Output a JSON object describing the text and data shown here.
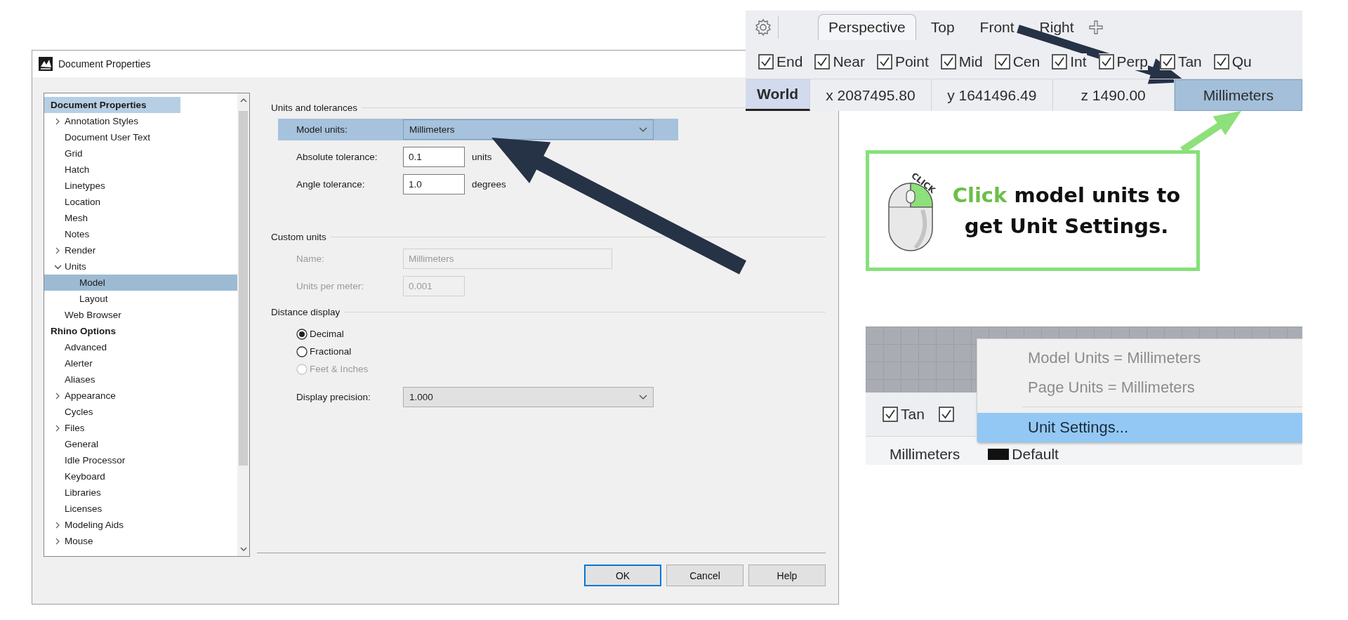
{
  "dialog": {
    "title": "Document Properties",
    "tree": [
      {
        "label": "Document Properties",
        "kind": "heading",
        "highlighted": true,
        "selected": false,
        "children": [
          {
            "label": "Annotation Styles",
            "kind": "item",
            "selected": false,
            "expanded": false
          },
          {
            "label": "Document User Text",
            "kind": "item",
            "selected": false
          },
          {
            "label": "Grid",
            "kind": "item",
            "selected": false
          },
          {
            "label": "Hatch",
            "kind": "item",
            "selected": false
          },
          {
            "label": "Linetypes",
            "kind": "item",
            "selected": false
          },
          {
            "label": "Location",
            "kind": "item",
            "selected": false
          },
          {
            "label": "Mesh",
            "kind": "item",
            "selected": false
          },
          {
            "label": "Notes",
            "kind": "item",
            "selected": false
          },
          {
            "label": "Render",
            "kind": "item",
            "selected": false,
            "expanded": false
          },
          {
            "label": "Units",
            "kind": "item",
            "selected": false,
            "expanded": true,
            "children": [
              {
                "label": "Model",
                "kind": "item",
                "selected": true
              },
              {
                "label": "Layout",
                "kind": "item",
                "selected": false
              }
            ]
          },
          {
            "label": "Web Browser",
            "kind": "item",
            "selected": false
          }
        ]
      },
      {
        "label": "Rhino Options",
        "kind": "heading",
        "highlighted": false,
        "selected": false,
        "children": [
          {
            "label": "Advanced",
            "kind": "item",
            "selected": false
          },
          {
            "label": "Alerter",
            "kind": "item",
            "selected": false
          },
          {
            "label": "Aliases",
            "kind": "item",
            "selected": false
          },
          {
            "label": "Appearance",
            "kind": "item",
            "selected": false,
            "expanded": false
          },
          {
            "label": "Cycles",
            "kind": "item",
            "selected": false
          },
          {
            "label": "Files",
            "kind": "item",
            "selected": false,
            "expanded": false
          },
          {
            "label": "General",
            "kind": "item",
            "selected": false
          },
          {
            "label": "Idle Processor",
            "kind": "item",
            "selected": false
          },
          {
            "label": "Keyboard",
            "kind": "item",
            "selected": false
          },
          {
            "label": "Libraries",
            "kind": "item",
            "selected": false
          },
          {
            "label": "Licenses",
            "kind": "item",
            "selected": false
          },
          {
            "label": "Modeling Aids",
            "kind": "item",
            "selected": false,
            "expanded": false
          },
          {
            "label": "Mouse",
            "kind": "item",
            "selected": false,
            "expanded": false
          }
        ]
      }
    ],
    "groups": [
      {
        "title": "Units and tolerances",
        "rows": [
          {
            "kind": "select",
            "label": "Model units:",
            "value": "Millimeters",
            "highlighted": true,
            "disabled": false
          },
          {
            "kind": "text",
            "label": "Absolute tolerance:",
            "value": "0.1",
            "suffix": "units",
            "highlighted": false,
            "disabled": false
          },
          {
            "kind": "text",
            "label": "Angle tolerance:",
            "value": "1.0",
            "suffix": "degrees",
            "highlighted": false,
            "disabled": false
          }
        ]
      },
      {
        "title": "Custom units",
        "rows": [
          {
            "kind": "wide-text",
            "label": "Name:",
            "value": "Millimeters",
            "highlighted": false,
            "disabled": true
          },
          {
            "kind": "text",
            "label": "Units per meter:",
            "value": "0.001",
            "highlighted": false,
            "disabled": true
          }
        ]
      },
      {
        "title": "Distance display",
        "rows": [
          {
            "kind": "radio",
            "label": "Decimal",
            "selected": true,
            "disabled": false
          },
          {
            "kind": "radio",
            "label": "Fractional",
            "selected": false,
            "disabled": false
          },
          {
            "kind": "radio",
            "label": "Feet & Inches",
            "selected": false,
            "disabled": true
          },
          {
            "kind": "select",
            "label": "Display precision:",
            "value": "1.000",
            "highlighted": false,
            "disabled": false
          }
        ]
      }
    ],
    "buttons": [
      {
        "label": "OK",
        "default": true
      },
      {
        "label": "Cancel",
        "default": false
      },
      {
        "label": "Help",
        "default": false
      }
    ]
  },
  "viewport_toolbar": {
    "tabs": [
      {
        "label": "Perspective",
        "selected": true
      },
      {
        "label": "Top",
        "selected": false
      },
      {
        "label": "Front",
        "selected": false
      },
      {
        "label": "Right",
        "selected": false
      }
    ],
    "snaps": [
      {
        "label": "End",
        "checked": true
      },
      {
        "label": "Near",
        "checked": true
      },
      {
        "label": "Point",
        "checked": true
      },
      {
        "label": "Mid",
        "checked": true
      },
      {
        "label": "Cen",
        "checked": true
      },
      {
        "label": "Int",
        "checked": true
      },
      {
        "label": "Perp",
        "checked": true
      },
      {
        "label": "Tan",
        "checked": true
      },
      {
        "label": "Qu",
        "checked": true
      }
    ],
    "status": [
      {
        "label": "World",
        "kind": "mode",
        "highlighted": false
      },
      {
        "label": "x 2087495.80",
        "kind": "coord",
        "highlighted": false
      },
      {
        "label": "y 1641496.49",
        "kind": "coord",
        "highlighted": false
      },
      {
        "label": "z 1490.00",
        "kind": "coord",
        "highlighted": false
      },
      {
        "label": "Millimeters",
        "kind": "units",
        "highlighted": true
      }
    ]
  },
  "callout": {
    "icon_caption": "CLICK",
    "highlight": "Click",
    "text": "model units to get Unit Settings."
  },
  "units_menu": {
    "snaps": [
      {
        "label": "Tan",
        "checked": true
      },
      {
        "checked": true
      }
    ],
    "status": [
      {
        "label": "Millimeters"
      },
      {
        "label": "Default"
      }
    ],
    "items": [
      {
        "label": "Model Units = Millimeters",
        "disabled": true,
        "selected": false
      },
      {
        "label": "Page Units = Millimeters",
        "disabled": true,
        "selected": false
      },
      {
        "label": "Unit Settings...",
        "disabled": false,
        "selected": true
      }
    ]
  }
}
